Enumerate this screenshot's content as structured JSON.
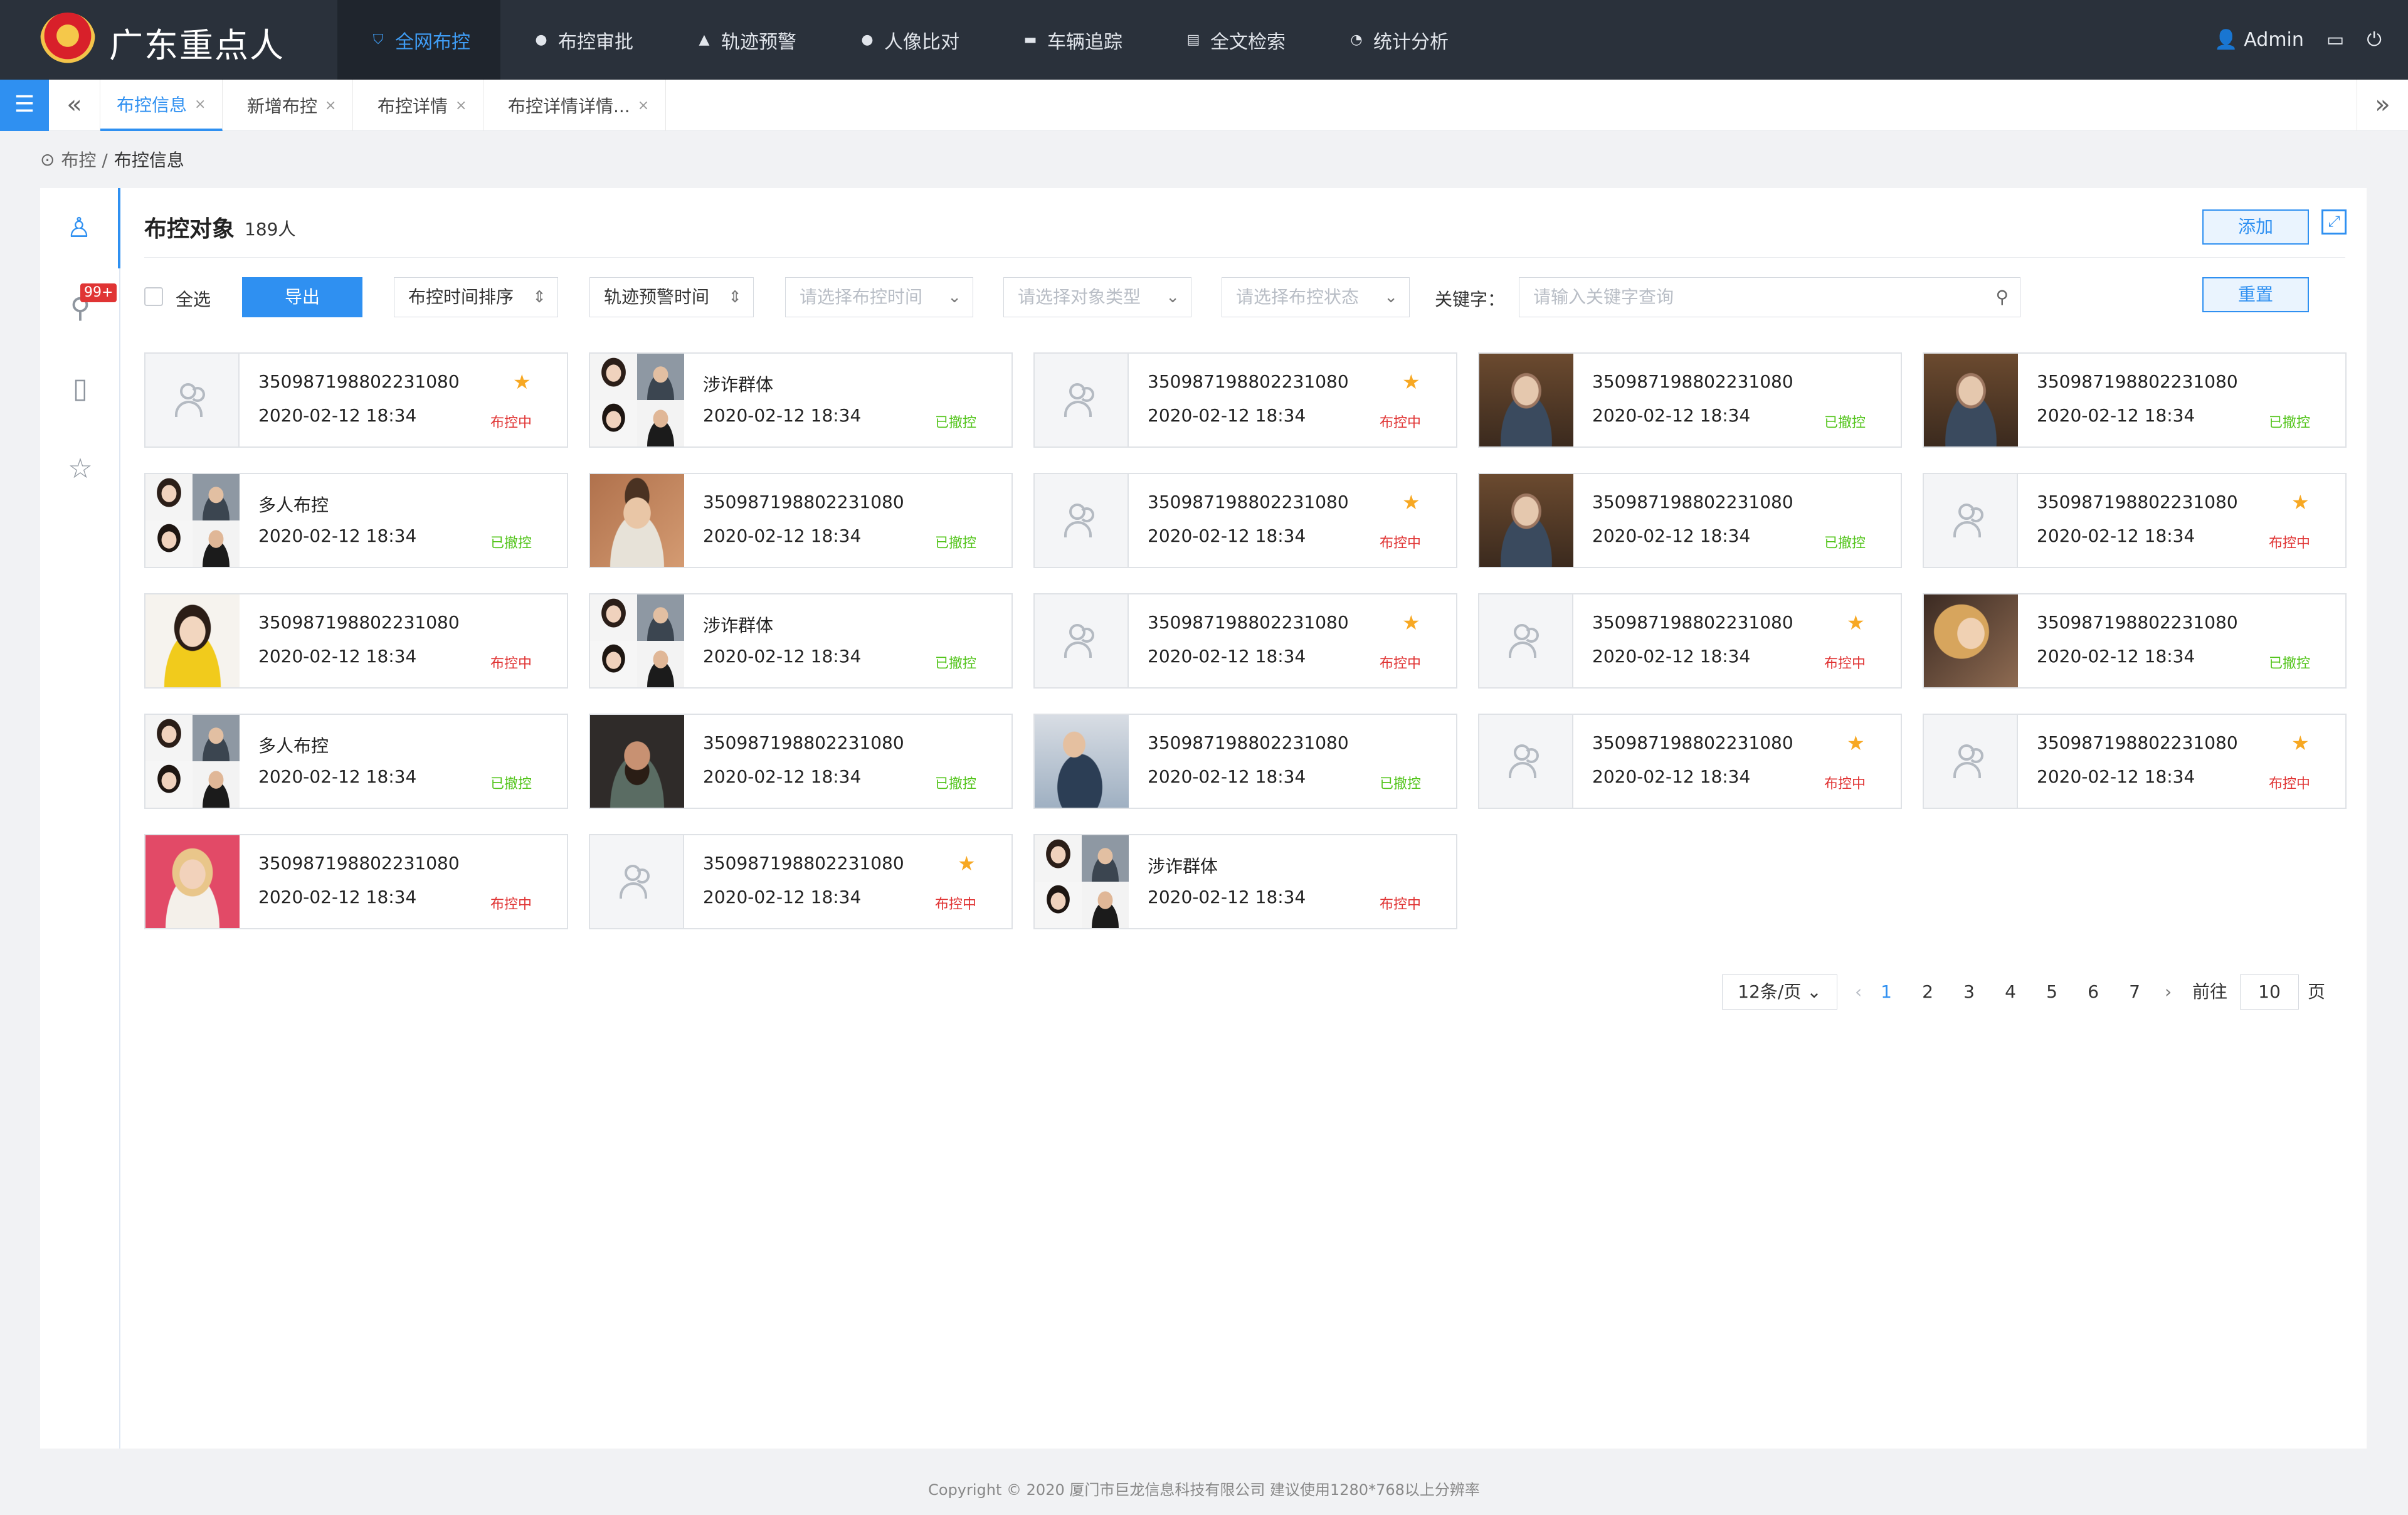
{
  "app": {
    "title": "广东重点人"
  },
  "nav": [
    {
      "label": "全网布控",
      "icon": "shield-icon",
      "active": true
    },
    {
      "label": "布控审批",
      "icon": "user-check-icon"
    },
    {
      "label": "轨迹预警",
      "icon": "alarm-icon"
    },
    {
      "label": "人像比对",
      "icon": "user-compare-icon"
    },
    {
      "label": "车辆追踪",
      "icon": "car-icon"
    },
    {
      "label": "全文检索",
      "icon": "document-search-icon"
    },
    {
      "label": "统计分析",
      "icon": "pie-chart-icon"
    }
  ],
  "user": {
    "name": "Admin"
  },
  "tabs": [
    {
      "label": "布控信息",
      "active": true
    },
    {
      "label": "新增布控"
    },
    {
      "label": "布控详情"
    },
    {
      "label": "布控详情详情..."
    }
  ],
  "breadcrumb": {
    "parent": "布控 /",
    "current": "布控信息"
  },
  "sidebar": {
    "badge": "99+"
  },
  "panel": {
    "title": "布控对象",
    "count": "189人",
    "add_label": "添加",
    "expand_glyph": "⤢"
  },
  "filters": {
    "select_all": "全选",
    "export": "导出",
    "sort1": "布控时间排序",
    "sort2": "轨迹预警时间",
    "select_time": "请选择布控时间",
    "select_type": "请选择对象类型",
    "select_status": "请选择布控状态",
    "keyword_label": "关键字：",
    "keyword_placeholder": "请输入关键字查询",
    "reset": "重置"
  },
  "cards": [
    {
      "line1": "350987198802231080",
      "date": "2020-02-12  18:34",
      "status": "布控中",
      "star": true,
      "thumb": "placeholder"
    },
    {
      "line1": "涉诈群体",
      "date": "2020-02-12  18:34",
      "status": "已撤控",
      "star": false,
      "thumb": "multi"
    },
    {
      "line1": "350987198802231080",
      "date": "2020-02-12  18:34",
      "status": "布控中",
      "star": true,
      "thumb": "placeholder"
    },
    {
      "line1": "350987198802231080",
      "date": "2020-02-12  18:34",
      "status": "已撤控",
      "star": false,
      "thumb": "old"
    },
    {
      "line1": "350987198802231080",
      "date": "2020-02-12  18:34",
      "status": "已撤控",
      "star": false,
      "thumb": "old"
    },
    {
      "line1": "多人布控",
      "date": "2020-02-12  18:34",
      "status": "已撤控",
      "star": false,
      "thumb": "multi"
    },
    {
      "line1": "350987198802231080",
      "date": "2020-02-12  18:34",
      "status": "已撤控",
      "star": false,
      "thumb": "glass"
    },
    {
      "line1": "350987198802231080",
      "date": "2020-02-12  18:34",
      "status": "布控中",
      "star": true,
      "thumb": "placeholder"
    },
    {
      "line1": "350987198802231080",
      "date": "2020-02-12  18:34",
      "status": "已撤控",
      "star": false,
      "thumb": "old"
    },
    {
      "line1": "350987198802231080",
      "date": "2020-02-12  18:34",
      "status": "布控中",
      "star": true,
      "thumb": "placeholder"
    },
    {
      "line1": "350987198802231080",
      "date": "2020-02-12  18:34",
      "status": "布控中",
      "star": false,
      "thumb": "girl"
    },
    {
      "line1": "涉诈群体",
      "date": "2020-02-12  18:34",
      "status": "已撤控",
      "star": false,
      "thumb": "multi"
    },
    {
      "line1": "350987198802231080",
      "date": "2020-02-12  18:34",
      "status": "布控中",
      "star": true,
      "thumb": "placeholder"
    },
    {
      "line1": "350987198802231080",
      "date": "2020-02-12  18:34",
      "status": "布控中",
      "star": true,
      "thumb": "placeholder"
    },
    {
      "line1": "350987198802231080",
      "date": "2020-02-12  18:34",
      "status": "已撤控",
      "star": false,
      "thumb": "curly"
    },
    {
      "line1": "多人布控",
      "date": "2020-02-12  18:34",
      "status": "已撤控",
      "star": false,
      "thumb": "multi"
    },
    {
      "line1": "350987198802231080",
      "date": "2020-02-12  18:34",
      "status": "已撤控",
      "star": false,
      "thumb": "beard"
    },
    {
      "line1": "350987198802231080",
      "date": "2020-02-12  18:34",
      "status": "已撤控",
      "star": false,
      "thumb": "phone"
    },
    {
      "line1": "350987198802231080",
      "date": "2020-02-12  18:34",
      "status": "布控中",
      "star": true,
      "thumb": "placeholder"
    },
    {
      "line1": "350987198802231080",
      "date": "2020-02-12  18:34",
      "status": "布控中",
      "star": true,
      "thumb": "placeholder"
    },
    {
      "line1": "350987198802231080",
      "date": "2020-02-12  18:34",
      "status": "布控中",
      "star": false,
      "thumb": "blonde"
    },
    {
      "line1": "350987198802231080",
      "date": "2020-02-12  18:34",
      "status": "布控中",
      "star": true,
      "thumb": "placeholder"
    },
    {
      "line1": "涉诈群体",
      "date": "2020-02-12  18:34",
      "status": "布控中",
      "star": false,
      "thumb": "multi"
    }
  ],
  "pagination": {
    "page_size": "12条/页",
    "pages": [
      "1",
      "2",
      "3",
      "4",
      "5",
      "6",
      "7"
    ],
    "current": "1",
    "goto_label": "前往",
    "goto_value": "10",
    "page_suffix": "页"
  },
  "footer": "Copyright © 2020  厦门市巨龙信息科技有限公司  建议使用1280*768以上分辨率",
  "colors": {
    "accent": "#2f90f1",
    "status_on": "#e03434",
    "status_off": "#52c41a",
    "star": "#f7a823",
    "topbar": "#2a313b"
  }
}
